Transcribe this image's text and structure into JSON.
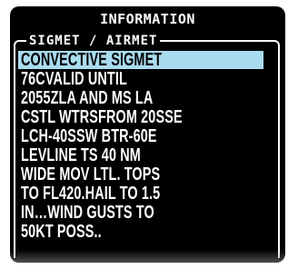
{
  "window": {
    "title": "INFORMATION"
  },
  "group": {
    "label": "SIGMET / AIRMET"
  },
  "text_lines": [
    "CONVECTIVE SIGMET",
    "76CVALID UNTIL",
    "2055ZLA AND MS LA",
    "CSTL WTRSFROM 20SSE",
    "LCH-40SSW BTR-60E",
    "LEVLINE TS 40 NM",
    "WIDE MOV LTL. TOPS",
    "TO FL420.HAIL TO 1.5",
    "IN…WIND GUSTS TO",
    "50KT POSS.."
  ],
  "selected_line_index": 0,
  "colors": {
    "background": "#000000",
    "text": "#ffffff",
    "selection_highlight": "#a9dcef",
    "selection_text": "#000000"
  }
}
